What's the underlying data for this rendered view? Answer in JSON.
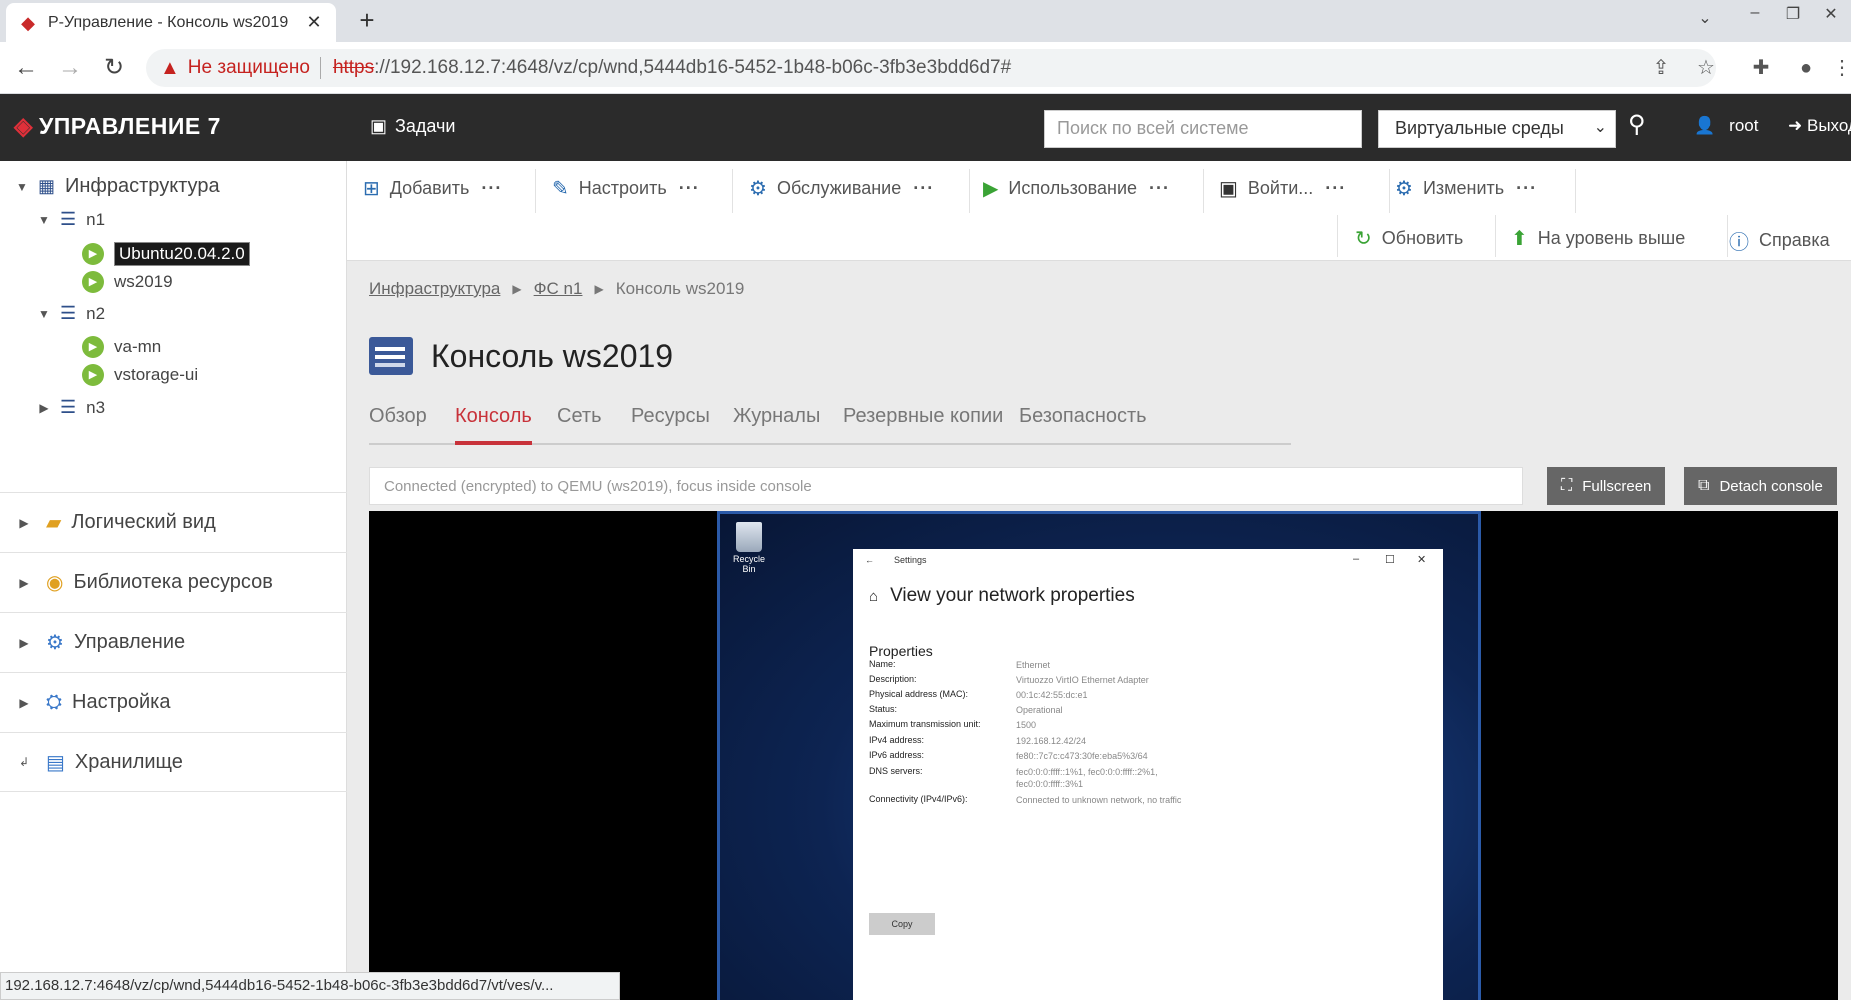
{
  "browser": {
    "tab_title": "Р-Управление - Консоль ws2019",
    "security_label": "Не защищено",
    "url_scheme": "https",
    "url_rest": "://192.168.12.7:4648/vz/cp/wnd,5444db16-5452-1b48-b06c-3fb3e3bdd6d7#",
    "status_url": "192.168.12.7:4648/vz/cp/wnd,5444db16-5452-1b48-b06c-3fb3e3bdd6d7/vt/ves/v..."
  },
  "header": {
    "logo_text": "УПРАВЛЕНИЕ 7",
    "tasks_label": "Задачи",
    "search_placeholder": "Поиск по всей системе",
    "env_select": "Виртуальные среды",
    "user": "root",
    "exit_label": "Выход"
  },
  "sidebar": {
    "infra_label": "Инфраструктура",
    "nodes": [
      {
        "name": "n1",
        "vms": [
          "Ubuntu20.04.2.0",
          "ws2019"
        ]
      },
      {
        "name": "n2",
        "vms": [
          "va-mn",
          "vstorage-ui"
        ]
      },
      {
        "name": "n3",
        "vms": []
      }
    ],
    "sections": [
      "Логический вид",
      "Библиотека ресурсов",
      "Управление",
      "Настройка",
      "Хранилище"
    ]
  },
  "toolbar": {
    "add": "Добавить",
    "configure": "Настроить",
    "service": "Обслуживание",
    "use": "Использование",
    "login": "Войти...",
    "change": "Изменить",
    "dots": "···",
    "refresh": "Обновить",
    "level_up": "На уровень выше",
    "help": "Справка"
  },
  "breadcrumb": {
    "items": [
      "Инфраструктура",
      "ФС n1",
      "Консоль ws2019"
    ]
  },
  "page_title": "Консоль ws2019",
  "tabs": [
    "Обзор",
    "Консоль",
    "Сеть",
    "Ресурсы",
    "Журналы",
    "Резервные копии",
    "Безопасность"
  ],
  "active_tab": "Консоль",
  "console": {
    "status": "Connected (encrypted) to QEMU (ws2019), focus inside console",
    "fullscreen": "Fullscreen",
    "detach": "Detach console"
  },
  "guest": {
    "recycle_bin": "Recycle Bin",
    "window_title": "Settings",
    "heading": "View your network properties",
    "section": "Properties",
    "properties": [
      {
        "k": "Name:",
        "v": "Ethernet"
      },
      {
        "k": "Description:",
        "v": "Virtuozzo VirtIO Ethernet Adapter"
      },
      {
        "k": "Physical address (MAC):",
        "v": "00:1c:42:55:dc:e1"
      },
      {
        "k": "Status:",
        "v": "Operational"
      },
      {
        "k": "Maximum transmission unit:",
        "v": "1500"
      },
      {
        "k": "IPv4 address:",
        "v": "192.168.12.42/24"
      },
      {
        "k": "IPv6 address:",
        "v": "fe80::7c7c:c473:30fe:eba5%3/64"
      },
      {
        "k": "DNS servers:",
        "v": "fec0:0:0:ffff::1%1, fec0:0:0:ffff::2%1, fec0:0:0:ffff::3%1"
      },
      {
        "k": "Connectivity (IPv4/IPv6):",
        "v": "Connected to unknown network, no traffic"
      }
    ],
    "copy_button": "Copy"
  },
  "colors": {
    "accent": "#c8323a",
    "header_bg": "#2b2b2b",
    "vm_running": "#7dbb3c"
  }
}
